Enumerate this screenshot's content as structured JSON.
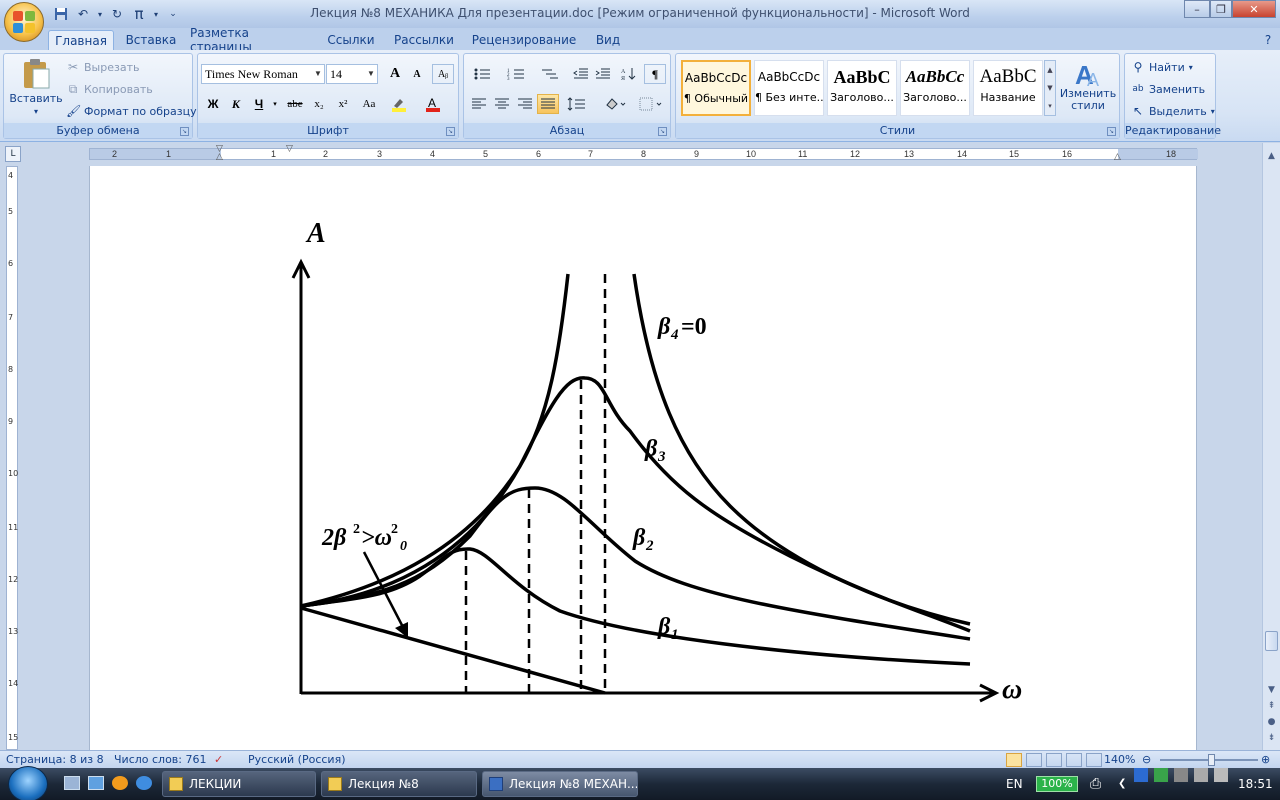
{
  "window": {
    "title": "Лекция №8 МЕХАНИКА Для презентации.doc [Режим ограниченной функциональности] - Microsoft Word",
    "undo_glyph": "↶",
    "redo_glyph": "↻",
    "pi_glyph": "π"
  },
  "tabs": [
    "Главная",
    "Вставка",
    "Разметка страницы",
    "Ссылки",
    "Рассылки",
    "Рецензирование",
    "Вид"
  ],
  "ribbon": {
    "clipboard": {
      "label": "Буфер обмена",
      "paste": "Вставить",
      "cut": "Вырезать",
      "copy": "Копировать",
      "format_painter": "Формат по образцу"
    },
    "font": {
      "label": "Шрифт",
      "font_name": "Times New Roman",
      "font_size": "14",
      "bold": "Ж",
      "italic": "К",
      "underline": "Ч",
      "strike": "abe",
      "subscript": "x₂",
      "superscript": "x²",
      "change_case": "Aa",
      "grow": "A",
      "shrink": "A"
    },
    "paragraph": {
      "label": "Абзац",
      "pilcrow": "¶"
    },
    "styles": {
      "label": "Стили",
      "tiles": [
        {
          "preview": "AaBbCcDc",
          "name": "¶ Обычный"
        },
        {
          "preview": "AaBbCcDc",
          "name": "¶ Без инте..."
        },
        {
          "preview": "AaBbC",
          "name": "Заголово..."
        },
        {
          "preview": "AaBbCc",
          "name": "Заголово..."
        },
        {
          "preview": "AaBbC",
          "name": "Название"
        }
      ],
      "change_styles": "Изменить стили"
    },
    "editing": {
      "label": "Редактирование",
      "find": "Найти",
      "replace": "Заменить",
      "select": "Выделить"
    }
  },
  "ruler": {
    "h_labels": [
      "2",
      "1",
      "1",
      "2",
      "3",
      "4",
      "5",
      "6",
      "7",
      "8",
      "9",
      "10",
      "11",
      "12",
      "13",
      "14",
      "15",
      "16",
      "18"
    ],
    "v_labels": [
      "4",
      "5",
      "6",
      "7",
      "8",
      "9",
      "10",
      "11",
      "12",
      "13",
      "14",
      "15"
    ]
  },
  "figure": {
    "y_axis_label": "A",
    "x_axis_label": "ω",
    "curve_labels": {
      "b4_sym": "β",
      "b4_sub": "4",
      "b4_eq": "=0",
      "b3_sym": "β",
      "b3_sub": "3",
      "b2_sym": "β",
      "b2_sub": "2",
      "b1_sym": "β",
      "b1_sub": "1"
    },
    "condition": {
      "a": "2β",
      "a_sup": "2",
      "b": ">ω",
      "b_sup": "2",
      "b_sub": "0"
    }
  },
  "statusbar": {
    "page": "Страница: 8 из 8",
    "words": "Число слов: 761",
    "language": "Русский (Россия)",
    "zoom": "140%"
  },
  "taskbar": {
    "tasks": [
      {
        "label": "ЛЕКЦИИ",
        "active": false
      },
      {
        "label": "Лекция №8",
        "active": false
      },
      {
        "label": "Лекция №8 МЕХАН...",
        "active": true
      }
    ],
    "lang": "EN",
    "battery": "100%",
    "clock": "18:51"
  }
}
